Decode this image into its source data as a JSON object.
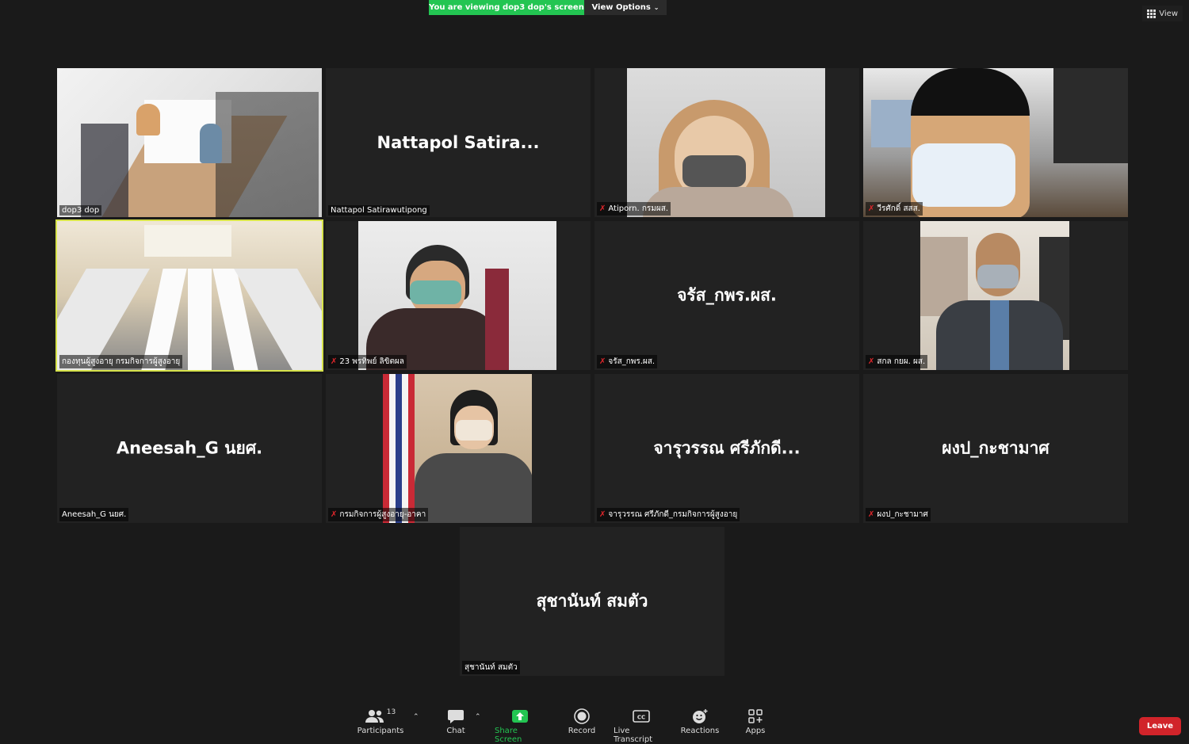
{
  "banner": {
    "text": "You are viewing dop3 dop's screen",
    "view_options": "View Options",
    "view": "View"
  },
  "tiles": {
    "t1": {
      "label": "dop3 dop"
    },
    "t2": {
      "big": "Nattapol  Satira...",
      "label": "Nattapol Satirawutipong"
    },
    "t3": {
      "label": "Atiporn. กรมผส."
    },
    "t4": {
      "label": "วีรศักดิ์ สสส."
    },
    "t5": {
      "label": "กองทุนผู้สูงอายุ กรมกิจการผู้สูงอายุ"
    },
    "t6": {
      "label": "23  พรทิพย์  ลิขิตผล"
    },
    "t7": {
      "big": "จรัส_กพร.ผส.",
      "label": "จรัส_กพร.ผส."
    },
    "t8": {
      "label": "สกล กยผ. ผส."
    },
    "t9": {
      "big": "Aneesah_G นยศ.",
      "label": "Aneesah_G นยศ."
    },
    "t10": {
      "label": "กรมกิจการผู้สูงอายุ-อาคา"
    },
    "t11": {
      "big": "จารุวรรณ ศรีภักดี...",
      "label": "จารุวรรณ ศรีภักดี_กรมกิจการผู้สูงอายุ"
    },
    "t12": {
      "big": "ผงป_กะชามาศ",
      "label": "ผงป_กะชามาศ"
    },
    "t13": {
      "big": "สุชานันท์ สมตัว",
      "label": "สุชานันท์ สมตัว"
    }
  },
  "toolbar": {
    "participants": "Participants",
    "participants_count": "13",
    "chat": "Chat",
    "share": "Share Screen",
    "record": "Record",
    "transcript": "Live Transcript",
    "reactions": "Reactions",
    "apps": "Apps",
    "leave": "Leave"
  },
  "colors": {
    "green": "#23c552",
    "leave": "#d1242a",
    "active_border": "#d7e34b"
  }
}
